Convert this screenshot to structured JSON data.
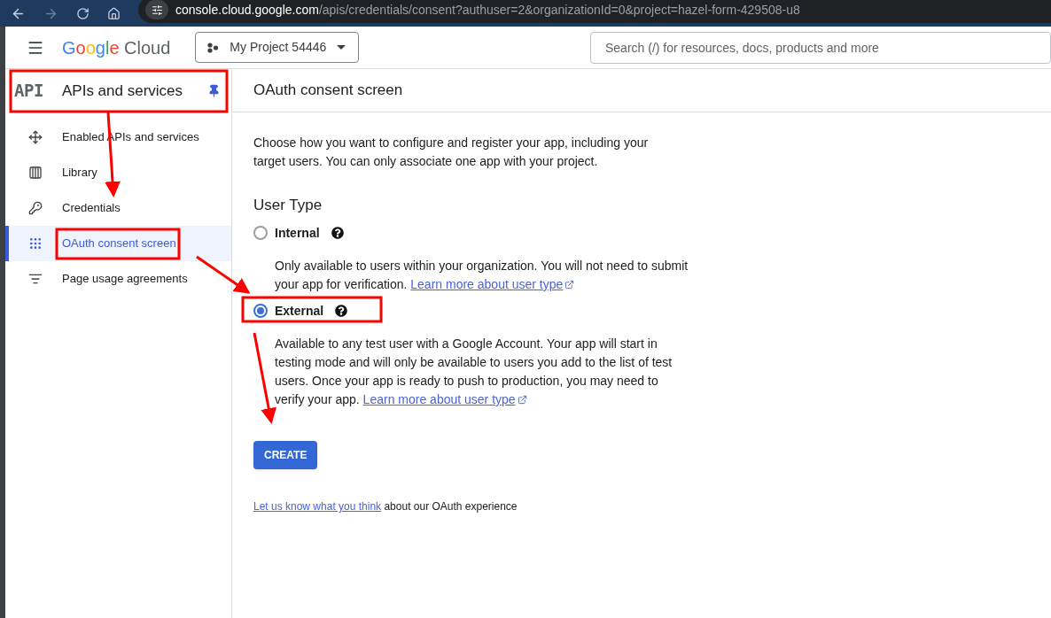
{
  "browser": {
    "url_domain": "console.cloud.google.com",
    "url_path": "/apis/credentials/consent?authuser=2&organizationId=0&project=hazel-form-429508-u8"
  },
  "header": {
    "logo_brand": "Google",
    "logo_product": "Cloud",
    "project": "My Project 54446",
    "search": {
      "placeholder": "Search (/) for resources, docs, products and more"
    }
  },
  "sidebar": {
    "badge": "API",
    "title": "APIs and services",
    "items": [
      {
        "kind": "enabled",
        "label": "Enabled APIs and services",
        "selected": false
      },
      {
        "kind": "library",
        "label": "Library",
        "selected": false
      },
      {
        "kind": "credentials",
        "label": "Credentials",
        "selected": false
      },
      {
        "kind": "oauth",
        "label": "OAuth consent screen",
        "selected": true
      },
      {
        "kind": "agreements",
        "label": "Page usage agreements",
        "selected": false
      }
    ]
  },
  "main": {
    "title": "OAuth consent screen",
    "intro": "Choose how you want to configure and register your app, including your target users. You can only associate one app with your project.",
    "section_title": "User Type",
    "options": [
      {
        "label": "Internal",
        "selected": false,
        "description": "Only available to users within your organization. You will not need to submit your app for verification.",
        "link": "Learn more about user type"
      },
      {
        "label": "External",
        "selected": true,
        "description": "Available to any test user with a Google Account. Your app will start in testing mode and will only be available to users you add to the list of test users. Once your app is ready to push to production, you may need to verify your app.",
        "link": "Learn more about user type"
      }
    ],
    "button": "CREATE",
    "feedback": {
      "link": "Let us know what you think",
      "text": "about our OAuth experience"
    }
  }
}
